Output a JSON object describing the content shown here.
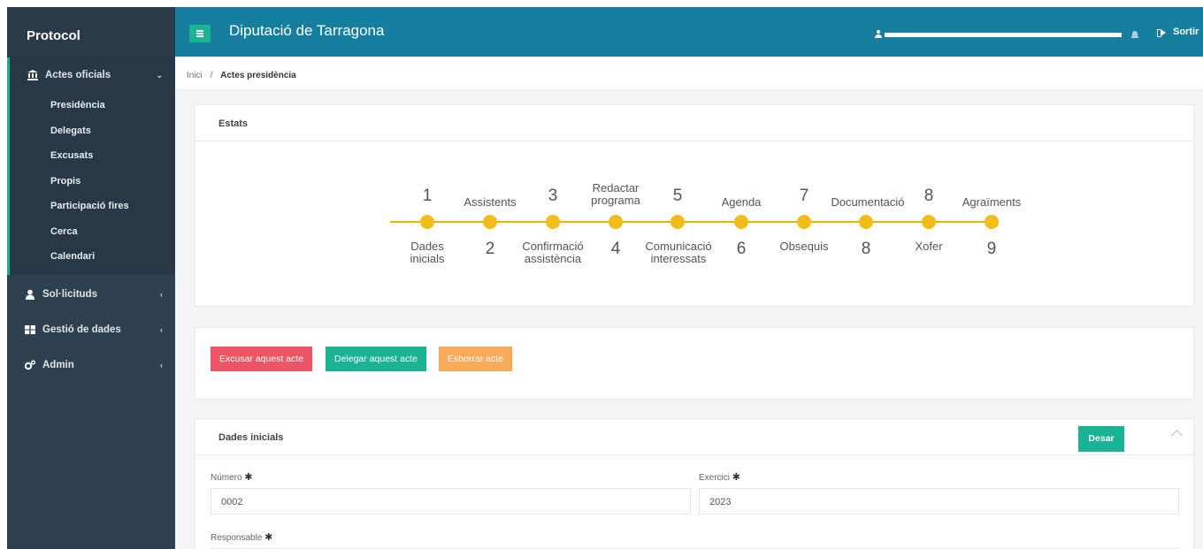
{
  "app": {
    "brand": "Protocol",
    "title": "Diputació de Tarragona",
    "logout_label": "Sortir"
  },
  "sidebar": {
    "groups": [
      {
        "label": "Actes oficials",
        "icon": "bank-icon",
        "expanded": true,
        "items": [
          "Presidència",
          "Delegats",
          "Excusats",
          "Propis",
          "Participació fires",
          "Cerca",
          "Calendari"
        ]
      },
      {
        "label": "Sol·licituds",
        "icon": "user-icon",
        "expanded": false
      },
      {
        "label": "Gestió de dades",
        "icon": "table-icon",
        "expanded": false
      },
      {
        "label": "Admin",
        "icon": "cogs-icon",
        "expanded": false
      }
    ]
  },
  "breadcrumb": {
    "home": "Inici",
    "separator": "/",
    "current": "Actes presidència"
  },
  "estats": {
    "title": "Estats",
    "steps": [
      {
        "num": "1",
        "label": "Dades inicials"
      },
      {
        "num": "2",
        "label": "Assistents"
      },
      {
        "num": "3",
        "label": "Confirmació assistència"
      },
      {
        "num": "4",
        "label": "Redactar programa"
      },
      {
        "num": "5",
        "label": "Comunicació interessats"
      },
      {
        "num": "6",
        "label": "Agenda"
      },
      {
        "num": "7",
        "label": "Obsequis"
      },
      {
        "num": "8",
        "label": "Documentació"
      },
      {
        "num": "8",
        "label": "Xofer"
      },
      {
        "num": "9",
        "label": "Agraïments"
      }
    ]
  },
  "actions": {
    "excusar": "Excusar aquest acte",
    "delegar": "Delegar aquest acte",
    "esborrar": "Esborrar acte"
  },
  "form": {
    "title": "Dades inicials",
    "save_label": "Desar",
    "numero_label": "Número",
    "numero_value": "0002",
    "exercici_label": "Exercici",
    "exercici_value": "2023",
    "responsable_label": "Responsable",
    "required_mark": "✱"
  },
  "colors": {
    "sidebar": "#2f4050",
    "header": "#167fa0",
    "accent": "#1ab394",
    "step_dot": "#f2bd16",
    "danger": "#ed5565",
    "warning": "#f8ac59"
  }
}
